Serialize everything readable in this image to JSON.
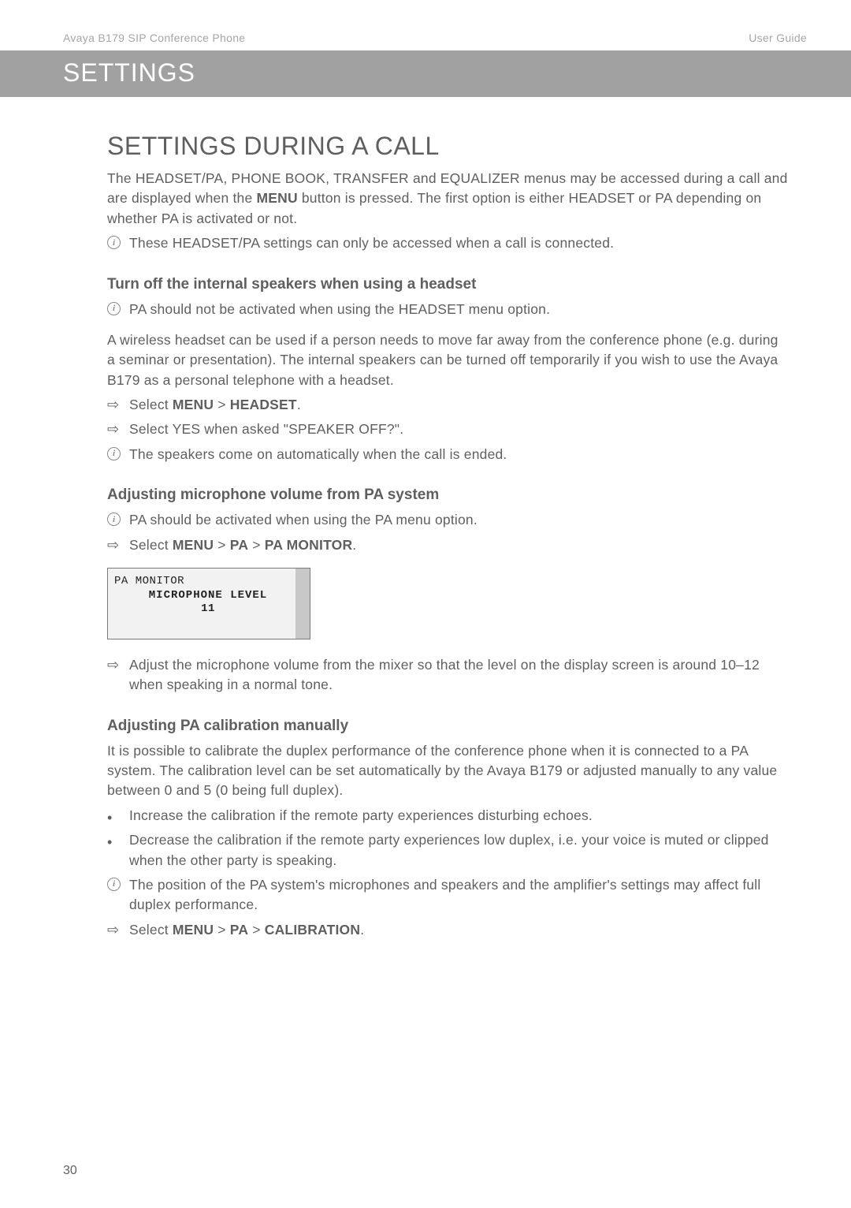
{
  "header": {
    "left": "Avaya B179 SIP Conference Phone",
    "right": "User Guide"
  },
  "banner": {
    "title": "SETTINGS"
  },
  "section": {
    "title": "SETTINGS DURING A CALL",
    "intro_a": "The HEADSET/PA, PHONE BOOK, TRANSFER and EQUALIZER menus may be accessed during a call and are displayed when the ",
    "intro_menu": "MENU",
    "intro_b": " button is pressed. The first option is either HEADSET or PA depending on whether PA is activated or not.",
    "info1": "These HEADSET/PA settings can only be accessed when a call is connected.",
    "sub1": {
      "title": "Turn off the internal speakers when using a headset",
      "info": "PA should not be activated when using the HEADSET menu option.",
      "para": "A wireless headset can be used if a person needs to move far away from the conference phone (e.g. during a seminar or presentation).  The internal speakers can be turned off temporarily if you wish to use the Avaya B179 as a personal telephone with a headset.",
      "step1_a": "Select ",
      "step1_b": "MENU",
      "step1_c": " > ",
      "step1_d": "HEADSET",
      "step1_e": ".",
      "step2": "Select YES when asked \"SPEAKER OFF?\".",
      "info2": "The speakers come on automatically when the call is ended."
    },
    "sub2": {
      "title": "Adjusting microphone volume from PA system",
      "info": "PA should be activated when using the PA menu option.",
      "step1_a": "Select ",
      "step1_b": "MENU",
      "step1_c": " > ",
      "step1_d": "PA",
      "step1_e": " > ",
      "step1_f": "PA MONITOR",
      "step1_g": ".",
      "lcd": {
        "line1": "PA MONITOR",
        "line2": "MICROPHONE LEVEL",
        "line3": "11"
      },
      "step2": "Adjust the microphone volume from the mixer so that the level on the display screen is around 10–12 when speaking in a normal tone."
    },
    "sub3": {
      "title": "Adjusting PA calibration manually",
      "para": "It is possible to calibrate the duplex performance of the conference phone when it is connected to a PA system. The calibration level can be set automatically by the Avaya B179 or adjusted manually to any value between 0 and 5 (0 being full duplex).",
      "bullet1": "Increase the calibration if the remote party experiences disturbing echoes.",
      "bullet2": "Decrease the calibration if the remote party experiences low duplex, i.e. your voice is muted or clipped when the other party is speaking.",
      "info": "The position of the PA system's microphones and speakers and the amplifier's settings may affect full duplex performance.",
      "step1_a": "Select ",
      "step1_b": "MENU",
      "step1_c": " > ",
      "step1_d": "PA",
      "step1_e": " > ",
      "step1_f": "CALIBRATION",
      "step1_g": "."
    }
  },
  "pageNumber": "30"
}
